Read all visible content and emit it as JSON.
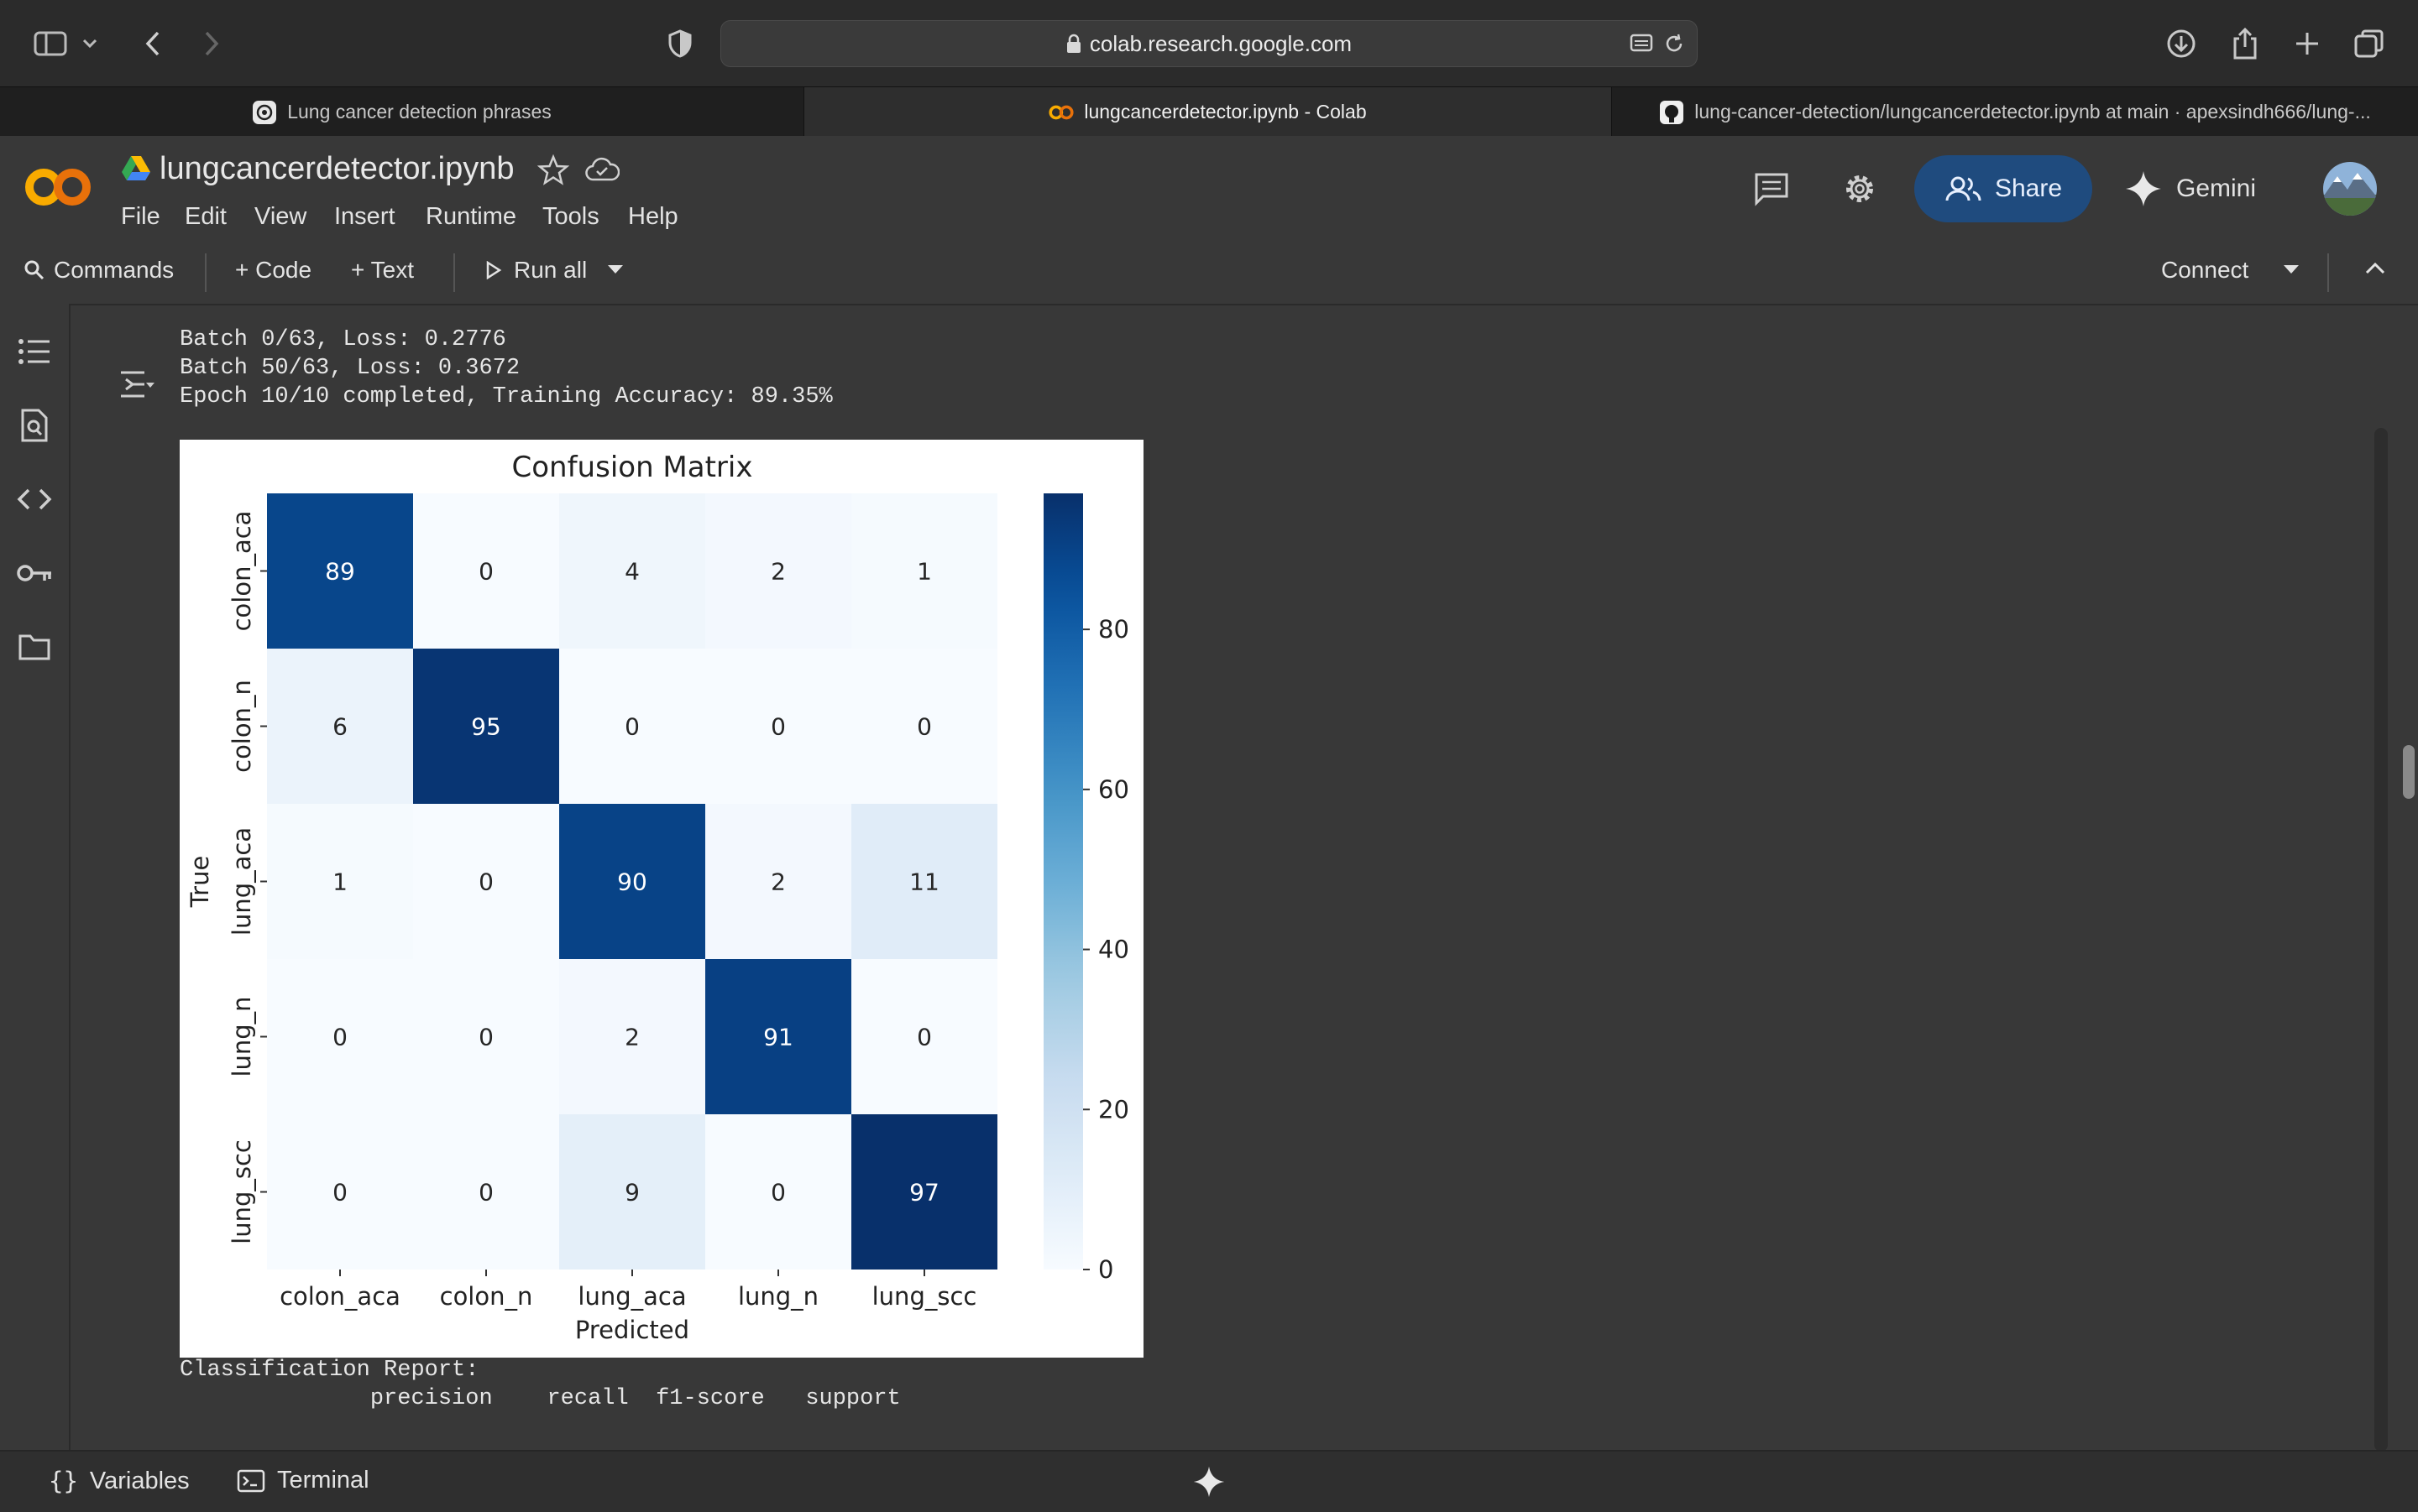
{
  "browser": {
    "url": "colab.research.google.com",
    "tabs": [
      {
        "label": "Lung cancer detection phrases",
        "active": false
      },
      {
        "label": "lungcancerdetector.ipynb - Colab",
        "active": true
      },
      {
        "label": "lung-cancer-detection/lungcancerdetector.ipynb at main · apexsindh666/lung-...",
        "active": false
      }
    ]
  },
  "colab": {
    "notebook_title": "lungcancerdetector.ipynb",
    "menu": [
      "File",
      "Edit",
      "View",
      "Insert",
      "Runtime",
      "Tools",
      "Help"
    ],
    "share_label": "Share",
    "gemini_label": "Gemini",
    "accent": "#1f4b7e"
  },
  "toolbar": {
    "commands_label": "Commands",
    "code_label": "+ Code",
    "text_label": "+ Text",
    "run_all_label": "Run all",
    "connect_label": "Connect"
  },
  "output": {
    "lines": [
      "Batch 0/63, Loss: 0.2776",
      "Batch 50/63, Loss: 0.3672",
      "Epoch 10/10 completed, Training Accuracy: 89.35%"
    ],
    "report_title": "Classification Report:",
    "report_header": "              precision    recall  f1-score   support"
  },
  "chart_data": {
    "type": "heatmap",
    "title": "Confusion Matrix",
    "xlabel": "Predicted",
    "ylabel": "True",
    "x_categories": [
      "colon_aca",
      "colon_n",
      "lung_aca",
      "lung_n",
      "lung_scc"
    ],
    "y_categories": [
      "colon_aca",
      "colon_n",
      "lung_aca",
      "lung_n",
      "lung_scc"
    ],
    "matrix": [
      [
        89,
        0,
        4,
        2,
        1
      ],
      [
        6,
        95,
        0,
        0,
        0
      ],
      [
        1,
        0,
        90,
        2,
        11
      ],
      [
        0,
        0,
        2,
        91,
        0
      ],
      [
        0,
        0,
        9,
        0,
        97
      ]
    ],
    "colormap": "Blues",
    "colorbar_range": [
      0,
      97
    ],
    "colorbar_ticks": [
      0,
      20,
      40,
      60,
      80
    ]
  },
  "bottom_bar": {
    "variables_label": "Variables",
    "terminal_label": "Terminal"
  }
}
